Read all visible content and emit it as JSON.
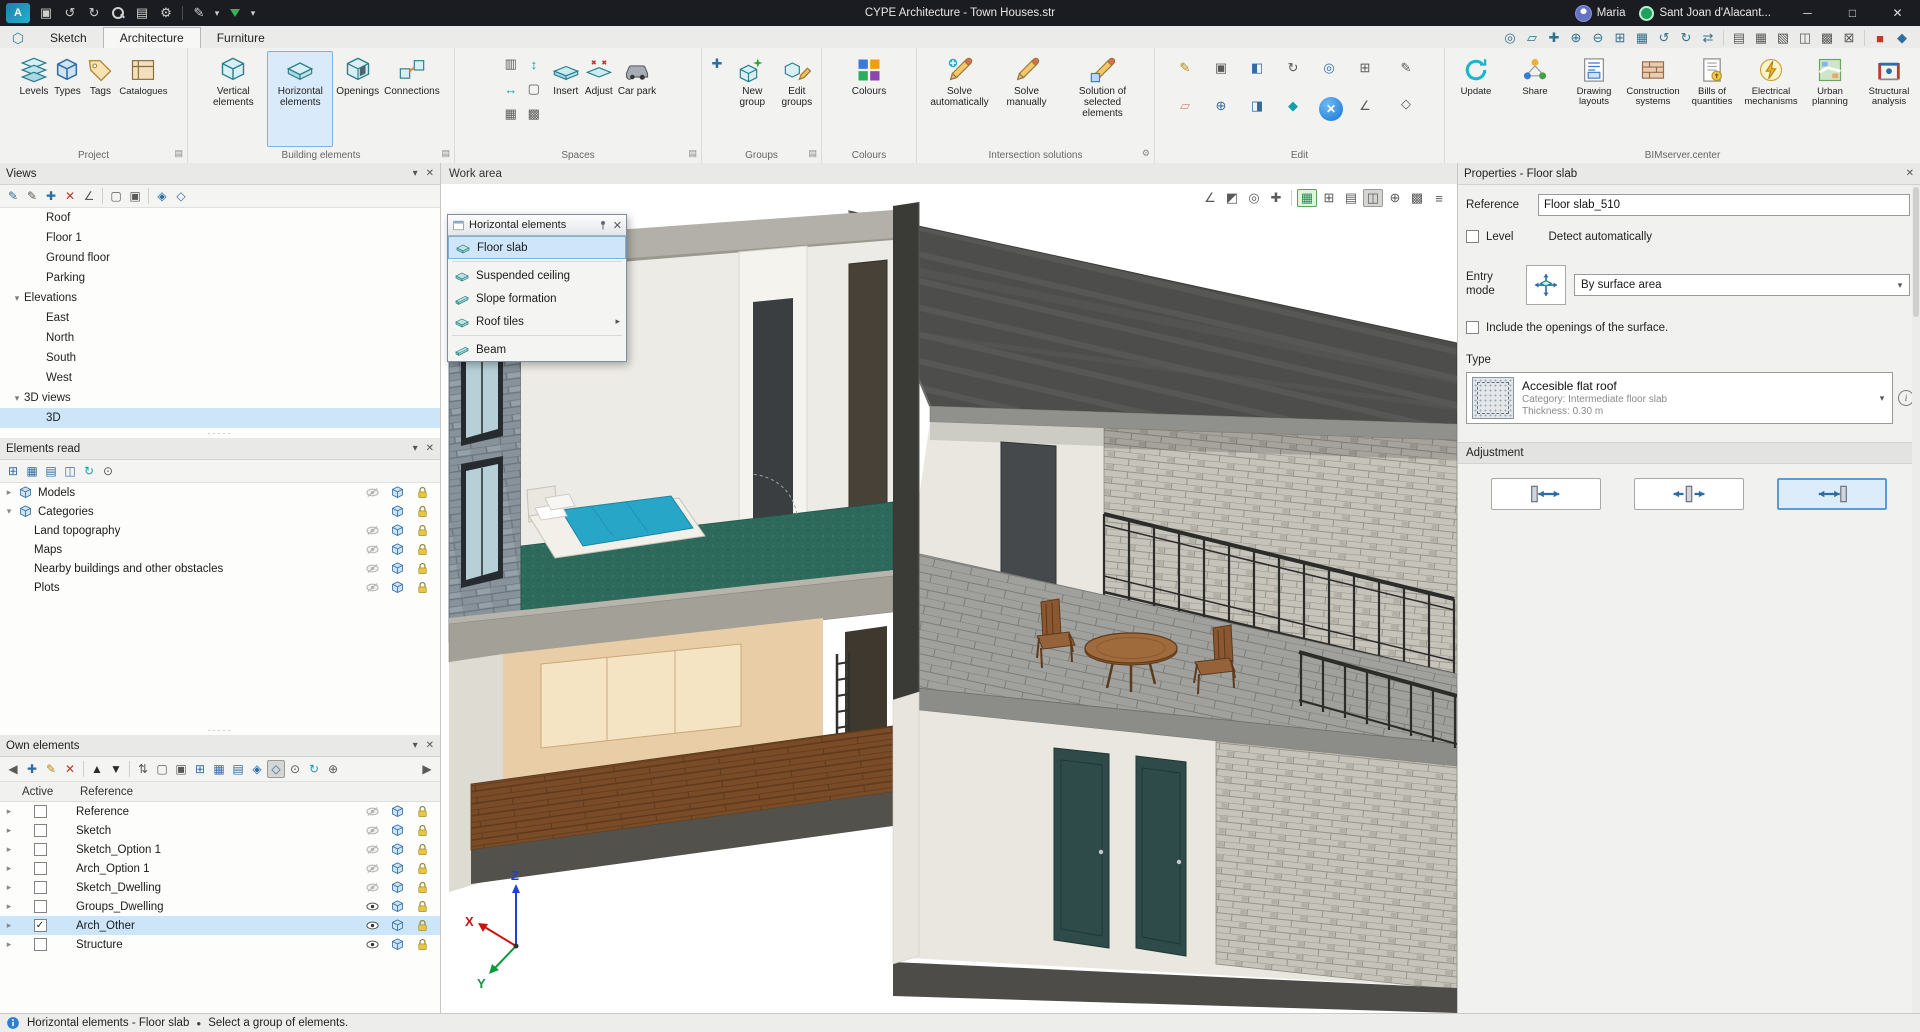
{
  "titlebar": {
    "title": "CYPE Architecture - Town Houses.str",
    "user": "Maria",
    "account": "Sant Joan d'Alacant..."
  },
  "tabs": {
    "items": [
      {
        "label": "Sketch"
      },
      {
        "label": "Architecture",
        "active": true
      },
      {
        "label": "Furniture"
      }
    ]
  },
  "ribbon": {
    "project": {
      "label": "Project",
      "buttons": [
        {
          "label": "Levels"
        },
        {
          "label": "Types"
        },
        {
          "label": "Tags"
        },
        {
          "label": "Catalogues"
        }
      ]
    },
    "building": {
      "label": "Building elements",
      "buttons": [
        {
          "label": "Vertical elements"
        },
        {
          "label": "Horizontal elements",
          "selected": true
        },
        {
          "label": "Openings"
        },
        {
          "label": "Connections"
        }
      ]
    },
    "spaces": {
      "label": "Spaces",
      "buttons": [
        {
          "label": "Insert"
        },
        {
          "label": "Adjust"
        },
        {
          "label": "Car park"
        }
      ]
    },
    "groups": {
      "label": "Groups",
      "buttons": [
        {
          "label": "New group"
        },
        {
          "label": "Edit groups"
        }
      ]
    },
    "colours": {
      "label": "Colours",
      "buttons": [
        {
          "label": "Colours"
        }
      ]
    },
    "intersection": {
      "label": "Intersection solutions",
      "buttons": [
        {
          "label": "Solve automatically"
        },
        {
          "label": "Solve manually"
        },
        {
          "label": "Solution of selected elements"
        }
      ]
    },
    "edit": {
      "label": "Edit"
    },
    "bim": {
      "label": "BIMserver.center",
      "buttons": [
        {
          "label": "Update"
        },
        {
          "label": "Share"
        },
        {
          "label": "Drawing layouts"
        },
        {
          "label": "Construction systems"
        },
        {
          "label": "Bills of quantities"
        },
        {
          "label": "Electrical mechanisms"
        },
        {
          "label": "Urban planning"
        },
        {
          "label": "Structural analysis"
        }
      ]
    }
  },
  "work_area": {
    "label": "Work area"
  },
  "he_menu": {
    "title": "Horizontal elements",
    "items": [
      {
        "label": "Floor slab",
        "selected": true
      },
      {
        "label": "Suspended ceiling"
      },
      {
        "label": "Slope formation"
      },
      {
        "label": "Roof tiles",
        "submenu": true
      },
      {
        "label": "Beam"
      }
    ]
  },
  "views": {
    "title": "Views",
    "items": [
      {
        "label": "Roof"
      },
      {
        "label": "Floor 1"
      },
      {
        "label": "Ground floor"
      },
      {
        "label": "Parking"
      },
      {
        "label": "Elevations",
        "group": true
      },
      {
        "label": "East"
      },
      {
        "label": "North"
      },
      {
        "label": "South"
      },
      {
        "label": "West"
      },
      {
        "label": "3D views",
        "group": true
      },
      {
        "label": "3D",
        "selected": true
      }
    ]
  },
  "elements_read": {
    "title": "Elements read",
    "rows": [
      {
        "label": "Models",
        "visible": false
      },
      {
        "label": "Categories",
        "group": true
      },
      {
        "label": "Land topography",
        "visible": false
      },
      {
        "label": "Maps",
        "visible": false
      },
      {
        "label": "Nearby buildings and other obstacles",
        "visible": false
      },
      {
        "label": "Plots",
        "visible": false
      }
    ]
  },
  "own": {
    "title": "Own elements",
    "columns": [
      {
        "label": "Active"
      },
      {
        "label": "Reference"
      }
    ],
    "rows": [
      {
        "label": "Reference",
        "checked": false,
        "visible": false
      },
      {
        "label": "Sketch",
        "checked": false,
        "visible": false
      },
      {
        "label": "Sketch_Option 1",
        "checked": false,
        "visible": false
      },
      {
        "label": "Arch_Option 1",
        "checked": false,
        "visible": false
      },
      {
        "label": "Sketch_Dwelling",
        "checked": false,
        "visible": false
      },
      {
        "label": "Groups_Dwelling",
        "checked": false,
        "visible": true
      },
      {
        "label": "Arch_Other",
        "checked": true,
        "visible": true,
        "selected": true
      },
      {
        "label": "Structure",
        "checked": false,
        "visible": true
      }
    ]
  },
  "properties": {
    "title": "Properties - Floor slab",
    "reference_label": "Reference",
    "reference_value": "Floor slab_510",
    "level_label": "Level",
    "detect_label": "Detect automatically",
    "entry_mode_label": "Entry mode",
    "entry_mode_value": "By surface area",
    "include_label": "Include the openings of the surface.",
    "type_label": "Type",
    "type_name": "Accesible flat roof",
    "type_category": "Category: Intermediate floor slab",
    "type_thickness": "Thickness: 0.30 m",
    "adjustment_label": "Adjustment",
    "adjustment_buttons": [
      {
        "name": "adjust-upper-face",
        "selected": false
      },
      {
        "name": "adjust-centre",
        "selected": false
      },
      {
        "name": "adjust-lower-face",
        "selected": true
      }
    ]
  },
  "status": {
    "left": "Horizontal elements - Floor slab",
    "bullet": "●",
    "hint": "Select a group of elements."
  },
  "axis": {
    "x": "X",
    "y": "Y",
    "z": "Z"
  },
  "icons": {
    "save": "▣",
    "undo": "↺",
    "redo": "↻",
    "print": "▤",
    "gear": "⚙",
    "pencil": "✎",
    "dropdown": "▾",
    "collapse": "▾",
    "expand": "▸",
    "minimize": "─",
    "maximize": "□",
    "close": "✕",
    "check": "✓",
    "add": "✚",
    "del": "✕",
    "prev": "◀",
    "next": "▶",
    "up": "▲",
    "down": "▼",
    "angle": "∠",
    "target": "◎",
    "pluscirc": "⊕",
    "minuscirc": "⊖",
    "grid": "▦",
    "gridbox": "⊞",
    "table": "▤",
    "panes": "◫",
    "shade": "▩",
    "lines": "≡",
    "half": "◩",
    "para": "▱",
    "swap": "⇄",
    "sort": "⇅",
    "copy": "▣",
    "copy2": "▢",
    "diamond": "◈",
    "odiamond": "◇",
    "dotcirc": "⊙",
    "refresh": "↻",
    "rows": "▧",
    "crossbox": "⊠",
    "redsq": "■",
    "bluedm": "◆",
    "vrect": "▥",
    "harrow": "↔",
    "varrow": "↕",
    "box": "▢",
    "mirror1": "◧",
    "mirror2": "◨",
    "handle": "·····"
  }
}
